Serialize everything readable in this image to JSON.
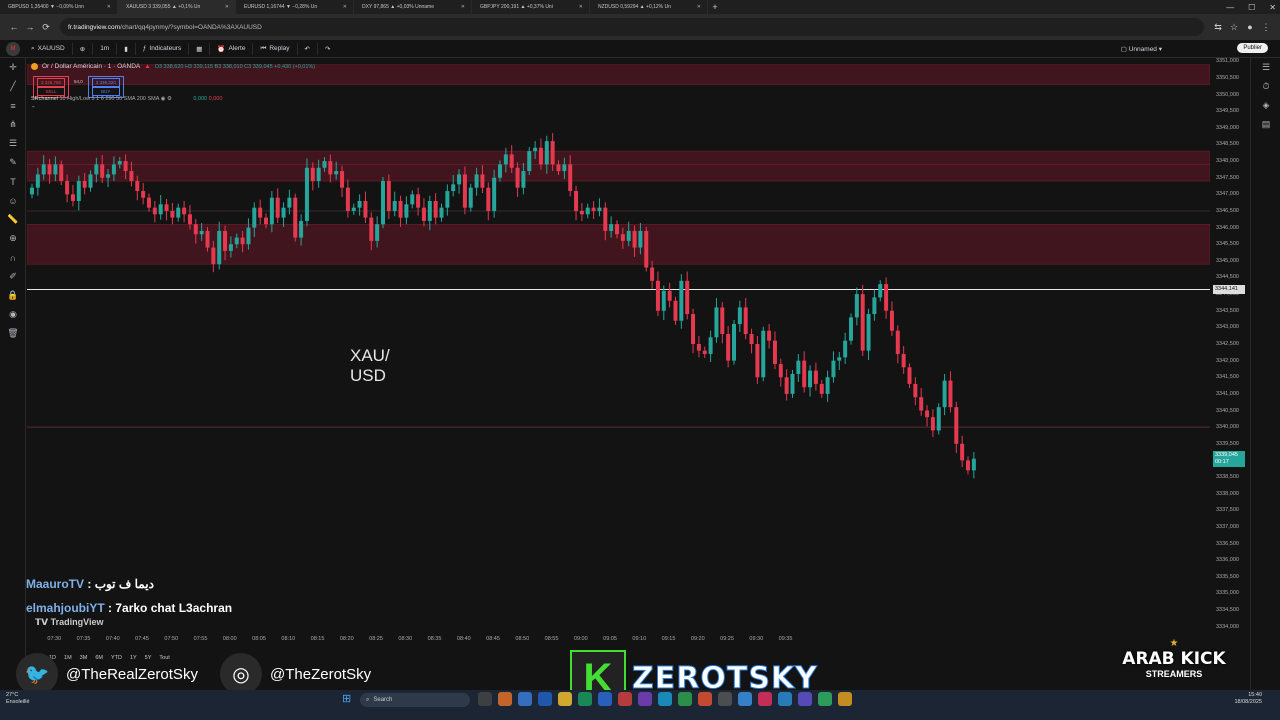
{
  "browser": {
    "tabs": [
      {
        "label": "GBPUSD 1,35400 ▼ −0,09% Unn"
      },
      {
        "label": "XAUUSD 3 339,055 ▲ +0,1% Un"
      },
      {
        "label": "EURUSD 1,16744 ▼ −0,28% Un"
      },
      {
        "label": "DXY 97,865 ▲ +0,03% Unname"
      },
      {
        "label": "GBPJPY 200,191 ▲ +0,37% Uni"
      },
      {
        "label": "NZDUSD 0,59294 ▲ +0,12% Un"
      }
    ],
    "url_host": "fr.tradingview.com",
    "url_path": "/chart/qq4pynmy/?symbol=OANDA%3AXAUUSD"
  },
  "toolbar": {
    "symbol": "XAUUSD",
    "interval": "1m",
    "indicators": "Indicateurs",
    "alert": "Alerte",
    "replay": "Replay",
    "layout_name": "Unnamed",
    "publish": "Publier"
  },
  "legend": {
    "title": "Or / Dollar Américain · 1 · OANDA",
    "ohlc": "O3 338,620 H3 339,115 B3 338,010 C3 339,045 +0,430 (+0,01%)",
    "sell_price": "3 338,780",
    "sell_label": "SELL",
    "spread": "54,0",
    "buy_price": "3 339,320",
    "buy_label": "BUY",
    "indicator_name": "SRchannel",
    "indicator_params": "10 High/Low 5 1 6 290 50 SMA 200 SMA",
    "indicator_v1": "0,000",
    "indicator_v2": "0,000"
  },
  "overlay_text": [
    "XAU/",
    "USD"
  ],
  "price_scale": {
    "ticks": [
      "3351,000",
      "3350,500",
      "3350,000",
      "3349,500",
      "3349,000",
      "3348,500",
      "3348,000",
      "3347,500",
      "3347,000",
      "3346,500",
      "3346,000",
      "3345,500",
      "3345,000",
      "3344,500",
      "3344,000",
      "3343,500",
      "3343,000",
      "3342,500",
      "3342,000",
      "3341,500",
      "3341,000",
      "3340,500",
      "3340,000",
      "3339,500",
      "3339,000",
      "3338,500",
      "3338,000",
      "3337,500",
      "3337,000",
      "3336,500",
      "3336,000",
      "3335,500",
      "3335,000",
      "3334,500",
      "3334,000"
    ],
    "hline_label": "3344,141",
    "last_price": "3339,045",
    "countdown": "00:17"
  },
  "time_axis": [
    "07:30",
    "07:35",
    "07:40",
    "07:45",
    "07:50",
    "07:55",
    "08:00",
    "08:05",
    "08:10",
    "08:15",
    "08:20",
    "08:25",
    "08:30",
    "08:35",
    "08:40",
    "08:45",
    "08:50",
    "08:55",
    "09:00",
    "09:05",
    "09:10",
    "09:15",
    "09:20",
    "09:25",
    "09:30",
    "09:35"
  ],
  "bottom_ranges": [
    "1D",
    "1M",
    "3M",
    "6M",
    "YTD",
    "1Y",
    "5Y",
    "Tout"
  ],
  "chat": [
    {
      "user": "MaauroTV",
      "msg": "ديما ف توب"
    },
    {
      "user": "elmahjoubiYT",
      "msg": "7arko chat L3achran"
    }
  ],
  "watermark": "TradingView",
  "social": {
    "twitter": "@TheRealZerotSky",
    "instagram": "@TheZerotSky"
  },
  "stream_logo": {
    "letter": "K",
    "name": "ZEROTSKY"
  },
  "badge": {
    "line1": "ARAB KICK",
    "line2": "STREAMERS"
  },
  "taskbar": {
    "search": "Search",
    "weather_temp": "27°C",
    "weather_desc": "Ensoleillé",
    "time": "15:40",
    "date": "18/08/2025"
  },
  "colors": {
    "up": "#26a69a",
    "down": "#e53950",
    "zone": "#5a1b24",
    "bg": "#131313"
  },
  "chart_data": {
    "type": "candlestick",
    "x_start": "07:26",
    "x_step_minutes": 1,
    "ylim": [
      3333.9,
      3351.1
    ],
    "zones": [
      [
        3350.3,
        3350.9
      ],
      [
        3347.9,
        3348.3
      ],
      [
        3347.4,
        3347.9
      ],
      [
        3344.9,
        3346.1
      ]
    ],
    "hlines": [
      3344.14,
      3340.0,
      3346.5
    ],
    "closes": [
      3347.2,
      3347.6,
      3347.9,
      3347.6,
      3347.9,
      3347.4,
      3347.0,
      3346.8,
      3347.4,
      3347.2,
      3347.6,
      3347.9,
      3347.5,
      3347.6,
      3347.9,
      3348.0,
      3347.7,
      3347.4,
      3347.1,
      3346.9,
      3346.6,
      3346.4,
      3346.7,
      3346.5,
      3346.3,
      3346.6,
      3346.4,
      3346.1,
      3345.8,
      3345.9,
      3345.4,
      3344.9,
      3345.9,
      3345.3,
      3345.5,
      3345.7,
      3345.5,
      3346.0,
      3346.6,
      3346.3,
      3346.1,
      3346.9,
      3346.3,
      3346.6,
      3346.9,
      3345.7,
      3346.2,
      3347.8,
      3347.4,
      3347.8,
      3348.0,
      3347.6,
      3347.7,
      3347.2,
      3346.5,
      3346.6,
      3346.8,
      3346.3,
      3345.6,
      3346.1,
      3347.4,
      3346.5,
      3346.8,
      3346.3,
      3346.7,
      3347.0,
      3346.6,
      3346.2,
      3346.8,
      3346.3,
      3346.6,
      3347.1,
      3347.3,
      3347.6,
      3346.6,
      3347.2,
      3347.6,
      3347.2,
      3346.5,
      3347.5,
      3347.9,
      3348.2,
      3347.8,
      3347.2,
      3347.7,
      3348.3,
      3348.4,
      3347.9,
      3348.6,
      3347.9,
      3347.7,
      3347.9,
      3347.1,
      3346.5,
      3346.4,
      3346.6,
      3346.5,
      3346.6,
      3345.9,
      3346.1,
      3345.8,
      3345.6,
      3345.9,
      3345.4,
      3345.9,
      3344.8,
      3344.4,
      3343.5,
      3344.1,
      3343.8,
      3343.2,
      3344.4,
      3343.4,
      3342.5,
      3342.3,
      3342.2,
      3342.7,
      3343.6,
      3342.8,
      3342.0,
      3343.1,
      3343.6,
      3342.8,
      3342.5,
      3341.5,
      3342.9,
      3342.6,
      3341.9,
      3341.5,
      3341.0,
      3341.6,
      3342.0,
      3341.2,
      3341.7,
      3341.3,
      3341.0,
      3341.5,
      3342.0,
      3342.1,
      3342.6,
      3343.3,
      3344.0,
      3342.3,
      3343.4,
      3343.9,
      3344.3,
      3343.5,
      3342.9,
      3342.2,
      3341.8,
      3341.3,
      3340.9,
      3340.5,
      3340.3,
      3339.9,
      3340.6,
      3341.4,
      3340.6,
      3339.5,
      3339.0,
      3338.7,
      3339.05
    ]
  }
}
